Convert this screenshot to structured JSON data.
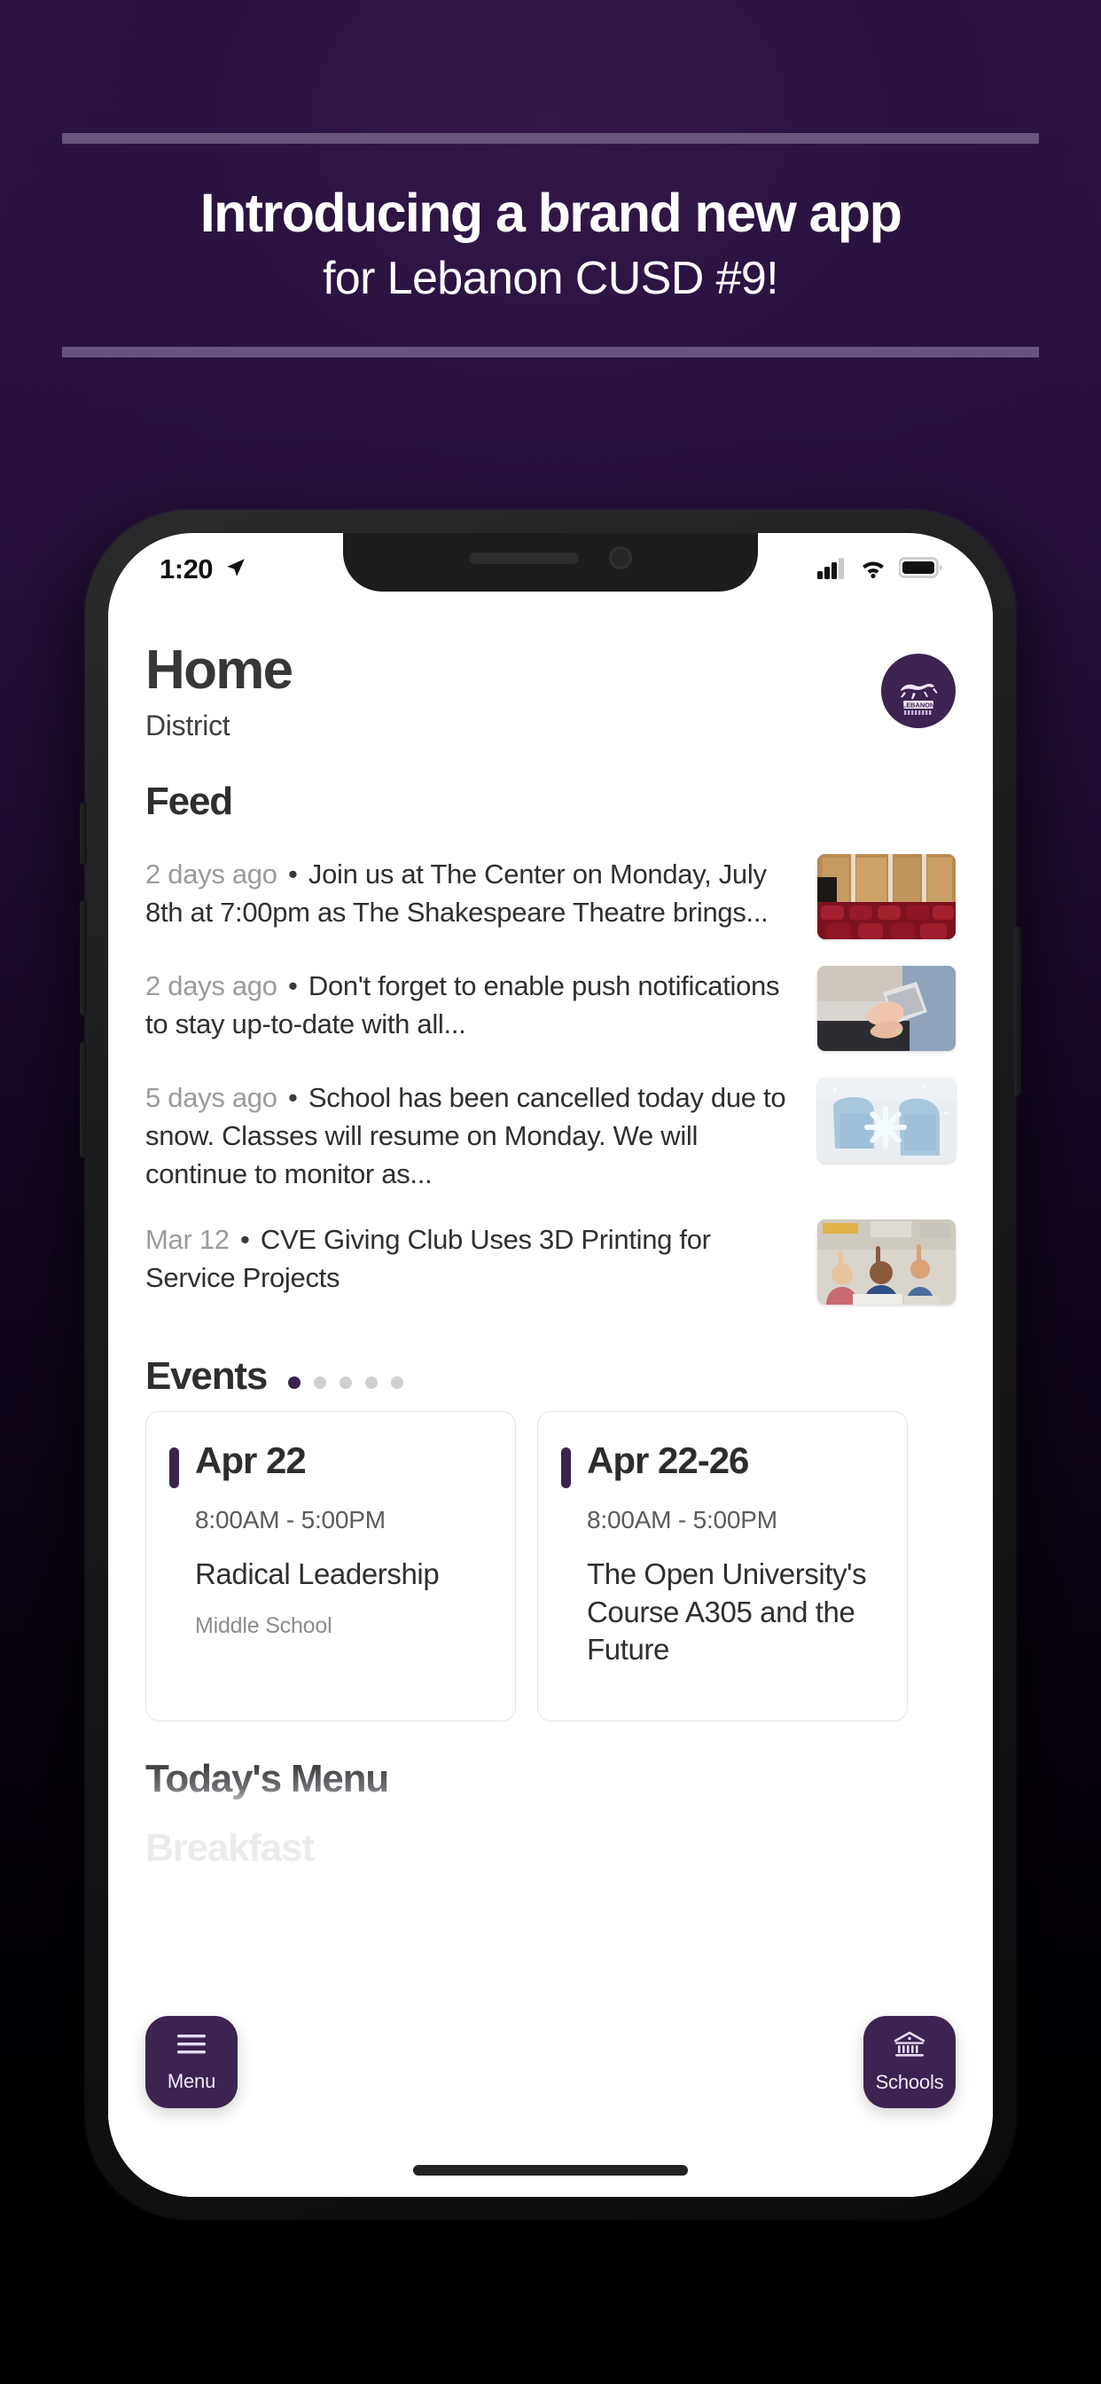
{
  "promo": {
    "line1": "Introducing a brand new app",
    "line2": "for Lebanon CUSD #9!",
    "rule_color": "#6b5980",
    "background_color": "#2a1240"
  },
  "phone": {
    "statusbar": {
      "time": "1:20",
      "location_icon": "location-arrow-icon",
      "signal_icon": "cellular-signal-icon",
      "wifi_icon": "wifi-icon",
      "battery_icon": "battery-icon"
    },
    "home_indicator": "home-indicator"
  },
  "app": {
    "accent_color": "#3c2352",
    "header": {
      "title": "Home",
      "subtitle": "District",
      "logo_alt": "Lebanon Greyhounds logo"
    },
    "feed": {
      "heading": "Feed",
      "items": [
        {
          "time": "2 days ago",
          "separator": "•",
          "text": "Join us at The Center on Monday, July 8th at 7:00pm as The Shakespeare Theatre brings...",
          "thumb": "theater-interior-thumbnail"
        },
        {
          "time": "2 days ago",
          "separator": "•",
          "text": "Don't forget to enable push notifications to stay up-to-date with all...",
          "thumb": "hands-holding-phone-thumbnail"
        },
        {
          "time": "5 days ago",
          "separator": "•",
          "text": "School has been cancelled today due to snow. Classes will resume on Monday. We will continue to monitor as...",
          "thumb": "mittens-snowflake-thumbnail"
        },
        {
          "time": "Mar 12",
          "separator": "•",
          "text": "CVE Giving Club Uses 3D Printing for Service Projects",
          "thumb": "classroom-students-thumbnail"
        }
      ]
    },
    "events": {
      "heading": "Events",
      "pager": {
        "total": 5,
        "active_index": 0
      },
      "cards": [
        {
          "date": "Apr 22",
          "time": "8:00AM  -  5:00PM",
          "name": "Radical Leadership",
          "location": "Middle School"
        },
        {
          "date": "Apr 22-26",
          "time": "8:00AM  -  5:00PM",
          "name": "The Open University's Course A305 and the Future",
          "location": ""
        }
      ]
    },
    "menu": {
      "heading": "Today's Menu",
      "meal": "Breakfast"
    },
    "fabs": [
      {
        "label": "Menu",
        "icon": "hamburger-menu-icon"
      },
      {
        "label": "Schools",
        "icon": "school-building-icon"
      }
    ]
  }
}
